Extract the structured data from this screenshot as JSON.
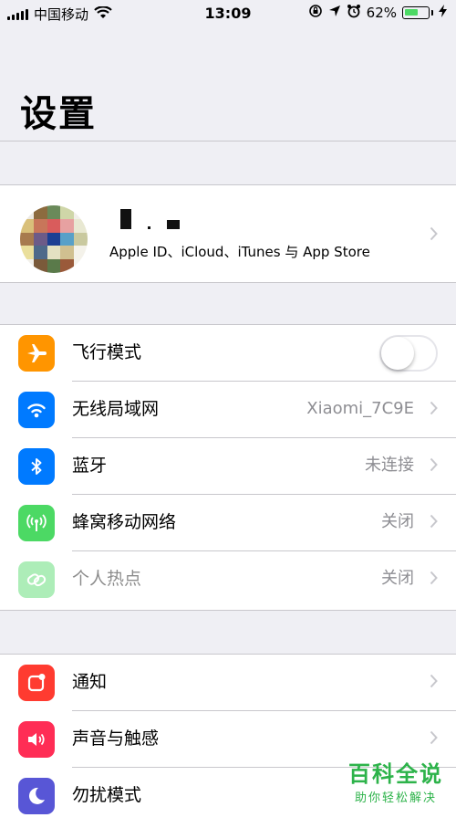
{
  "status_bar": {
    "carrier": "中国移动",
    "time": "13:09",
    "battery_text": "62%",
    "battery_level": 0.62,
    "icons": [
      "signal-icon",
      "wifi-icon",
      "orientation-lock-icon",
      "location-icon",
      "alarm-icon",
      "battery-icon",
      "charging-bolt-icon"
    ]
  },
  "header": {
    "title": "设置"
  },
  "profile": {
    "subtitle": "Apple ID、iCloud、iTunes 与 App Store"
  },
  "groups": [
    {
      "rows": [
        {
          "id": "airplane",
          "label": "飞行模式",
          "icon": "airplane-icon",
          "icon_color": "#ff9500",
          "toggle": true,
          "toggle_on": false
        },
        {
          "id": "wifi",
          "label": "无线局域网",
          "value": "Xiaomi_7C9E",
          "icon": "wifi-icon",
          "icon_color": "#007aff"
        },
        {
          "id": "bluetooth",
          "label": "蓝牙",
          "value": "未连接",
          "icon": "bluetooth-icon",
          "icon_color": "#007aff"
        },
        {
          "id": "cellular",
          "label": "蜂窝移动网络",
          "value": "关闭",
          "icon": "antenna-icon",
          "icon_color": "#4cd964"
        },
        {
          "id": "hotspot",
          "label": "个人热点",
          "value": "关闭",
          "icon": "hotspot-icon",
          "icon_color": "#4cd964",
          "disabled": true
        }
      ]
    },
    {
      "rows": [
        {
          "id": "notifications",
          "label": "通知",
          "icon": "notification-icon",
          "icon_color": "#ff3b30"
        },
        {
          "id": "sounds",
          "label": "声音与触感",
          "icon": "speaker-icon",
          "icon_color": "#ff2d55"
        },
        {
          "id": "dnd",
          "label": "勿扰模式",
          "icon": "moon-icon",
          "icon_color": "#5856d6"
        }
      ]
    }
  ],
  "watermark": {
    "main": "百科全说",
    "sub": "助你轻松解决"
  },
  "colors": {
    "background": "#efeff4",
    "accent_green": "#2db34a",
    "separator": "#c8c7cc"
  }
}
